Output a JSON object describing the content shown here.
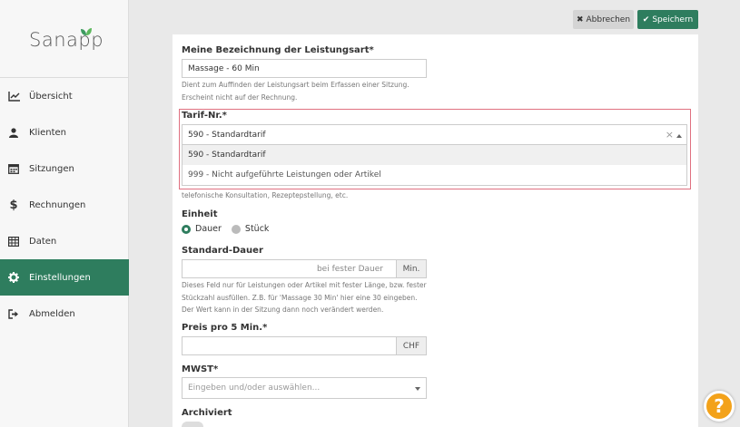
{
  "app": {
    "logo_text": "Sanapp"
  },
  "sidebar": {
    "items": [
      {
        "label": "Übersicht",
        "icon": "chart-line-icon"
      },
      {
        "label": "Klienten",
        "icon": "user-icon"
      },
      {
        "label": "Sitzungen",
        "icon": "calendar-icon"
      },
      {
        "label": "Rechnungen",
        "icon": "dollar-icon"
      },
      {
        "label": "Daten",
        "icon": "table-icon"
      },
      {
        "label": "Einstellungen",
        "icon": "gear-icon",
        "active": true
      },
      {
        "label": "Abmelden",
        "icon": "sign-out-icon"
      }
    ]
  },
  "toolbar": {
    "cancel_label": "Abbrechen",
    "save_label": "Speichern"
  },
  "form": {
    "bezeichnung": {
      "label": "Meine Bezeichnung der Leistungsart*",
      "value": "Massage - 60 Min",
      "help_line1": "Dient zum Auffinden der Leistungsart beim Erfassen einer Sitzung.",
      "help_line2": "Erscheint nicht auf der Rechnung."
    },
    "tarif": {
      "label": "Tarif-Nr.*",
      "value": "590 - Standardtarif",
      "clear": "×",
      "options": [
        "590 - Standardtarif",
        "999 - Nicht aufgeführte Leistungen oder Artikel"
      ],
      "help_tail": "telefonische Konsultation, Rezeptерstellung, etc."
    },
    "einheit": {
      "label": "Einheit",
      "options": [
        "Dauer",
        "Stück"
      ],
      "selected": "Dauer"
    },
    "dauer": {
      "label": "Standard-Dauer",
      "placeholder": "bei fester Dauer",
      "addon": "Min.",
      "help_line1": "Dieses Feld nur für Leistungen oder Artikel mit fester Länge, bzw. fester",
      "help_line2": "Stückzahl ausfüllen. Z.B. für 'Massage 30 Min' hier eine 30 eingeben.",
      "help_line3": "Der Wert kann in der Sitzung dann noch verändert werden."
    },
    "preis": {
      "label": "Preis pro 5 Min.*",
      "value": "",
      "addon": "CHF"
    },
    "mwst": {
      "label": "MWST*",
      "placeholder": "Eingeben und/oder auswählen..."
    },
    "archiviert": {
      "label": "Archiviert"
    }
  },
  "help_button": {
    "label": "?"
  },
  "colors": {
    "accent": "#2e7d5e",
    "help": "#f3a21a",
    "error_border": "#e07080"
  }
}
